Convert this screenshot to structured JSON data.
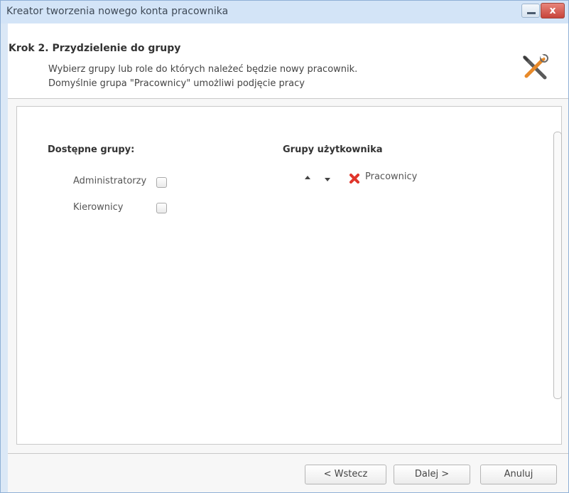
{
  "window": {
    "title": "Kreator tworzenia nowego konta pracownika",
    "close_label": "x"
  },
  "header": {
    "step_title": "Krok 2. Przydzielenie do grupy",
    "desc_line1": "Wybierz grupy lub role do których należeć będzie nowy pracownik.",
    "desc_line2": "Domyślnie grupa \"Pracownicy\" umożliwi podjęcie pracy",
    "icon": "tools-icon"
  },
  "available_groups": {
    "title": "Dostępne grupy:",
    "items": [
      {
        "label": "Administratorzy",
        "checked": false
      },
      {
        "label": "Kierownicy",
        "checked": false
      }
    ]
  },
  "user_groups": {
    "title": "Grupy użytkownika",
    "items": [
      {
        "label": "Pracownicy",
        "icons": [
          "arrow-up-icon",
          "arrow-down-icon",
          "remove-icon"
        ]
      }
    ]
  },
  "footer": {
    "back_label": "< Wstecz",
    "next_label": "Dalej >",
    "cancel_label": "Anuluj"
  },
  "colors": {
    "title_bar": "#d3e4f7",
    "close_button": "#c7443a",
    "remove_icon": "#e0352b"
  }
}
